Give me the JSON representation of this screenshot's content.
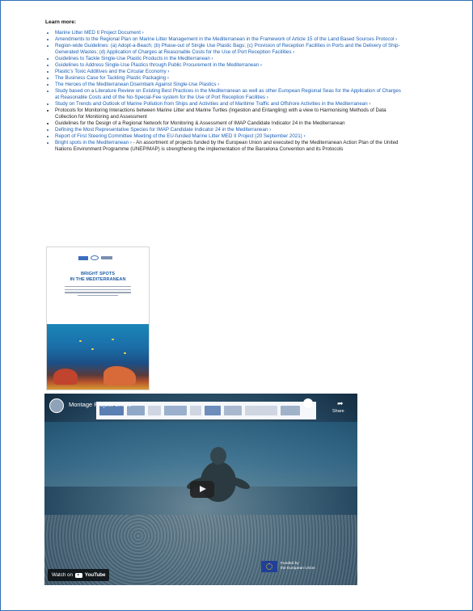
{
  "section": {
    "heading": "Learn more:"
  },
  "links": [
    {
      "text": "Marine Litter MED II Project Document ›",
      "type": "link"
    },
    {
      "text": "Amendments to the Regional Plan on Marine Litter Management in the Mediterranean in the Framework of Article 15 of the Land Based Sources Protocol ›",
      "type": "link"
    },
    {
      "text": "Region-wide Guidelines: (a) Adopt-a-Beach; (b) Phase-out of Single Use Plastic Bags; (c) Provision of Reception Facilities in Ports and the Delivery of Ship-Generated Wastes; (d) Application of Charges at Reasonable Costs for the Use of Port Reception Facilities ›",
      "type": "link"
    },
    {
      "text": "Guidelines to Tackle Single-Use Plastic Products in the Mediterranean ›",
      "type": "link"
    },
    {
      "text": "Guidelines to Address Single-Use Plastics through Public Procurement in the Mediterranean ›",
      "type": "link"
    },
    {
      "text": "Plastic’s Toxic Additives and the Circular Economy ›",
      "type": "link"
    },
    {
      "text": "The Business Case for Tackling Plastic Packaging ›",
      "type": "link"
    },
    {
      "text": "The Heroes of the Mediterranean Disembark Against Single-Use Plastics ›",
      "type": "link"
    },
    {
      "text": "Study based on a Literature Review on Existing Best Practices in the Mediterranean as well as other European Regional Seas for the Application of Charges at Reasonable Costs and of the No-Special-Fee system for the Use of Port Reception Facilities ›",
      "type": "link"
    },
    {
      "text": "Study on Trends and Outlook of Marine Pollution from Ships and Activities and of Maritime Traffic and Offshore Activities in the Mediterranean ›",
      "type": "link"
    },
    {
      "text": "Protocols for Monitoring Interactions between Marine Litter and Marine Turtles (Ingestion and Entangling) with a view to Harmonising Methods of Data Collection for Monitoring and Assessment",
      "type": "plain"
    },
    {
      "text": "Guidelines for the Design of a Regional Network for Monitoring & Assessment of IMAP Candidate Indicator 24 in the Mediterranean",
      "type": "plain"
    },
    {
      "text": "Defining the Most Representative Species for IMAP Candidate Indicator 24 in the Mediterranean ›",
      "type": "link"
    },
    {
      "text": "Report of First Steering Committee Meeting of the EU-funded Marine Litter MED II Project (20 September 2021) ›",
      "type": "link"
    }
  ],
  "bright_spots": {
    "link_text": "Bright spots in the Mediterranean ›",
    "description": " - An assortment of projects funded by the European Union and executed by the Mediterranean Action Plan of the United Nations Environment Programme (UNEP/MAP) is strengthening the implementation of the Barcelona Convention and its Protocols"
  },
  "cover": {
    "title_line1": "BRIGHT SPOTS",
    "title_line2": "IN THE MEDITERRANEAN"
  },
  "video": {
    "title": "Montage Project UK 01",
    "share_label": "Share",
    "watch_on": "Watch on",
    "youtube": "YouTube",
    "eu_line1": "Funded by",
    "eu_line2": "the European Union"
  }
}
